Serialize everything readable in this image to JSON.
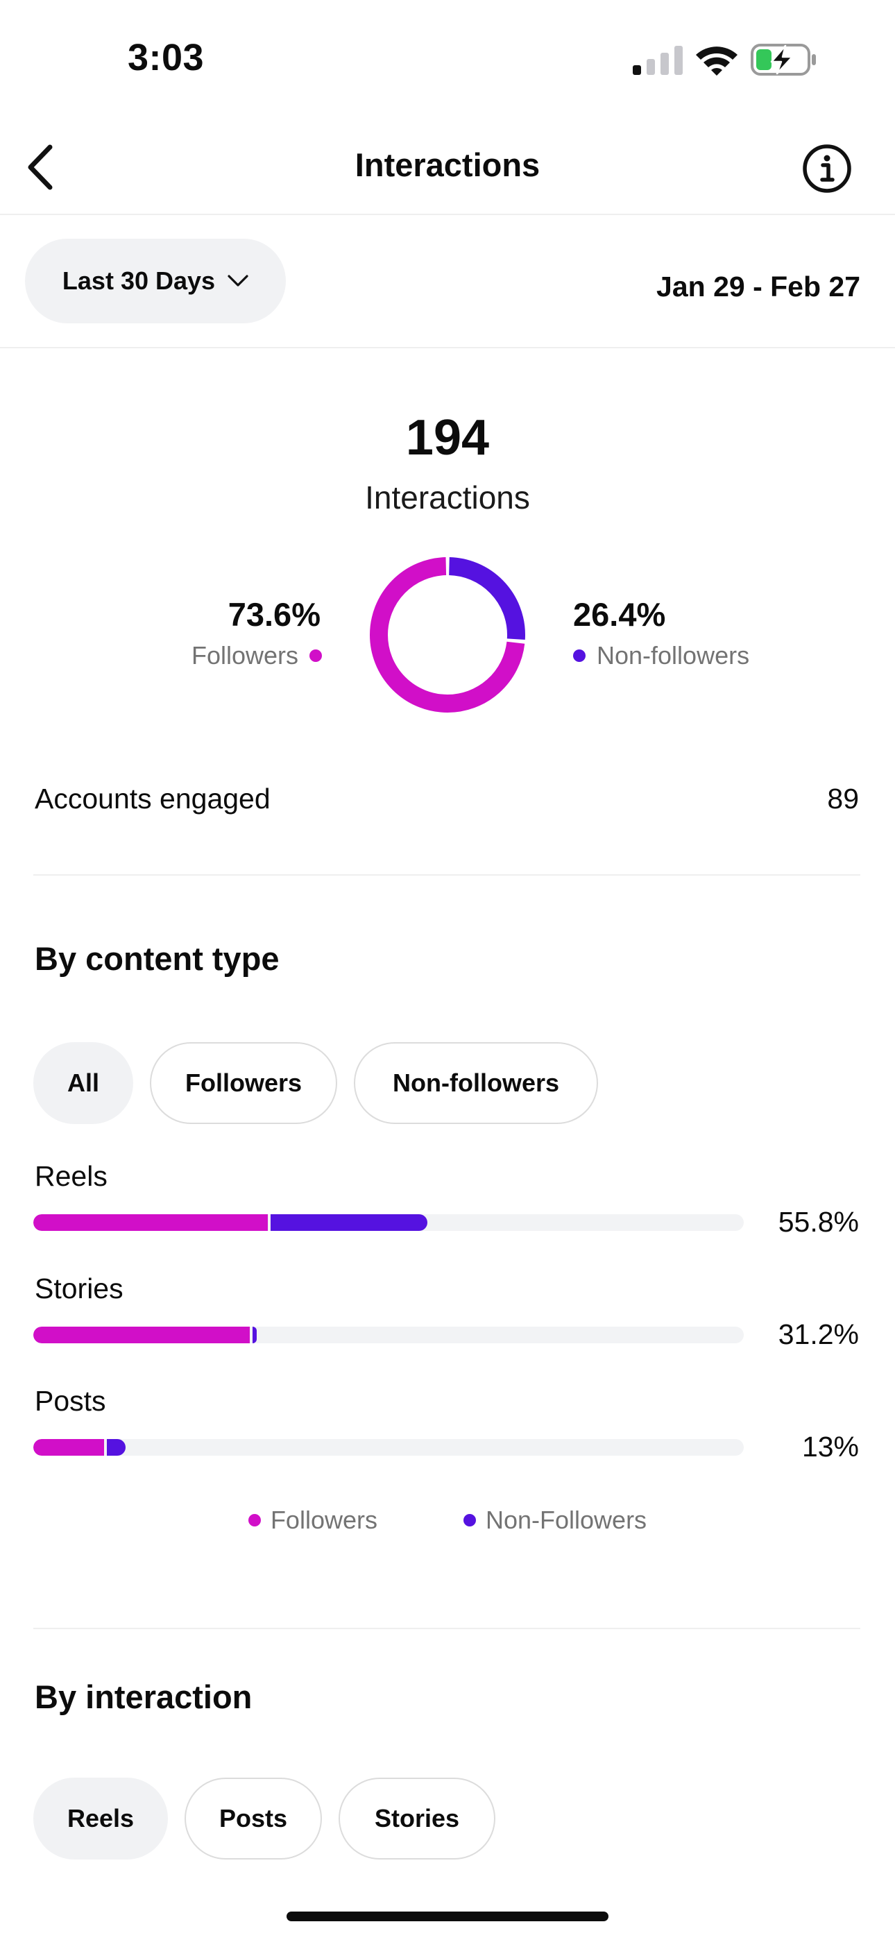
{
  "status_bar": {
    "time": "3:03"
  },
  "header": {
    "title": "Interactions"
  },
  "period": {
    "selector_label": "Last 30 Days",
    "date_range": "Jan 29 - Feb 27"
  },
  "summary": {
    "total": "194",
    "total_label": "Interactions",
    "followers": {
      "percent": "73.6%",
      "label": "Followers",
      "share": 0.736
    },
    "non_followers": {
      "percent": "26.4%",
      "label": "Non-followers",
      "share": 0.264
    }
  },
  "accounts_engaged": {
    "label": "Accounts engaged",
    "value": "89"
  },
  "by_content_type": {
    "title": "By content type",
    "filters": [
      "All",
      "Followers",
      "Non-followers"
    ],
    "active_filter": "All",
    "rows": [
      {
        "label": "Reels",
        "percent": "55.8%",
        "followers_fraction": 0.33,
        "non_followers_fraction": 0.225
      },
      {
        "label": "Stories",
        "percent": "31.2%",
        "followers_fraction": 0.305,
        "non_followers_fraction": 0.007
      },
      {
        "label": "Posts",
        "percent": "13%",
        "followers_fraction": 0.1,
        "non_followers_fraction": 0.03
      }
    ],
    "legend": {
      "followers": "Followers",
      "non_followers": "Non-Followers"
    }
  },
  "by_interaction": {
    "title": "By interaction",
    "tabs": [
      "Reels",
      "Posts",
      "Stories"
    ],
    "active_tab": "Reels"
  },
  "colors": {
    "followers": "#d10fc8",
    "non_followers": "#5512e0",
    "track": "#f2f3f5",
    "chip_active": "#f1f2f4"
  }
}
